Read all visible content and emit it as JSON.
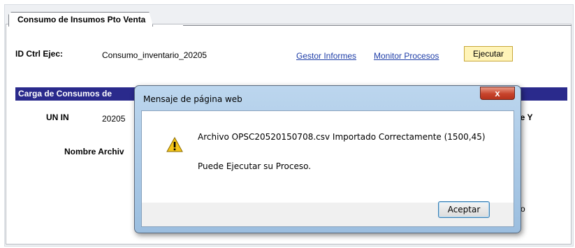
{
  "tab": {
    "label": "Consumo de Insumos Pto Venta"
  },
  "run_control": {
    "label": "ID Ctrl Ejec:",
    "value": "Consumo_inventario_20205",
    "report_manager_link": "Gestor Informes",
    "process_monitor_link": "Monitor Procesos",
    "run_button": "Ejecutar"
  },
  "section": {
    "title": "Carga de Consumos de",
    "unit_label": "UN IN",
    "unit_value": "20205",
    "file_name_label": "Nombre Archiv",
    "right_partial_text": "ce  Y",
    "right_partial_text2": "o"
  },
  "dialog": {
    "title": "Mensaje de página web",
    "close_symbol": "x",
    "message_line1": "Archivo OPSC20520150708.csv Importado Correctamente (1500,45)",
    "message_line2": "Puede Ejecutar su Proceso.",
    "accept_button": "Aceptar",
    "icon": "warning-icon"
  },
  "colors": {
    "section_bar": "#2a2a8c",
    "link": "#1f3ea8",
    "run_button_bg": "#fff4b8",
    "dialog_chrome": "#bcd6ee",
    "close_button": "#c7442c"
  }
}
